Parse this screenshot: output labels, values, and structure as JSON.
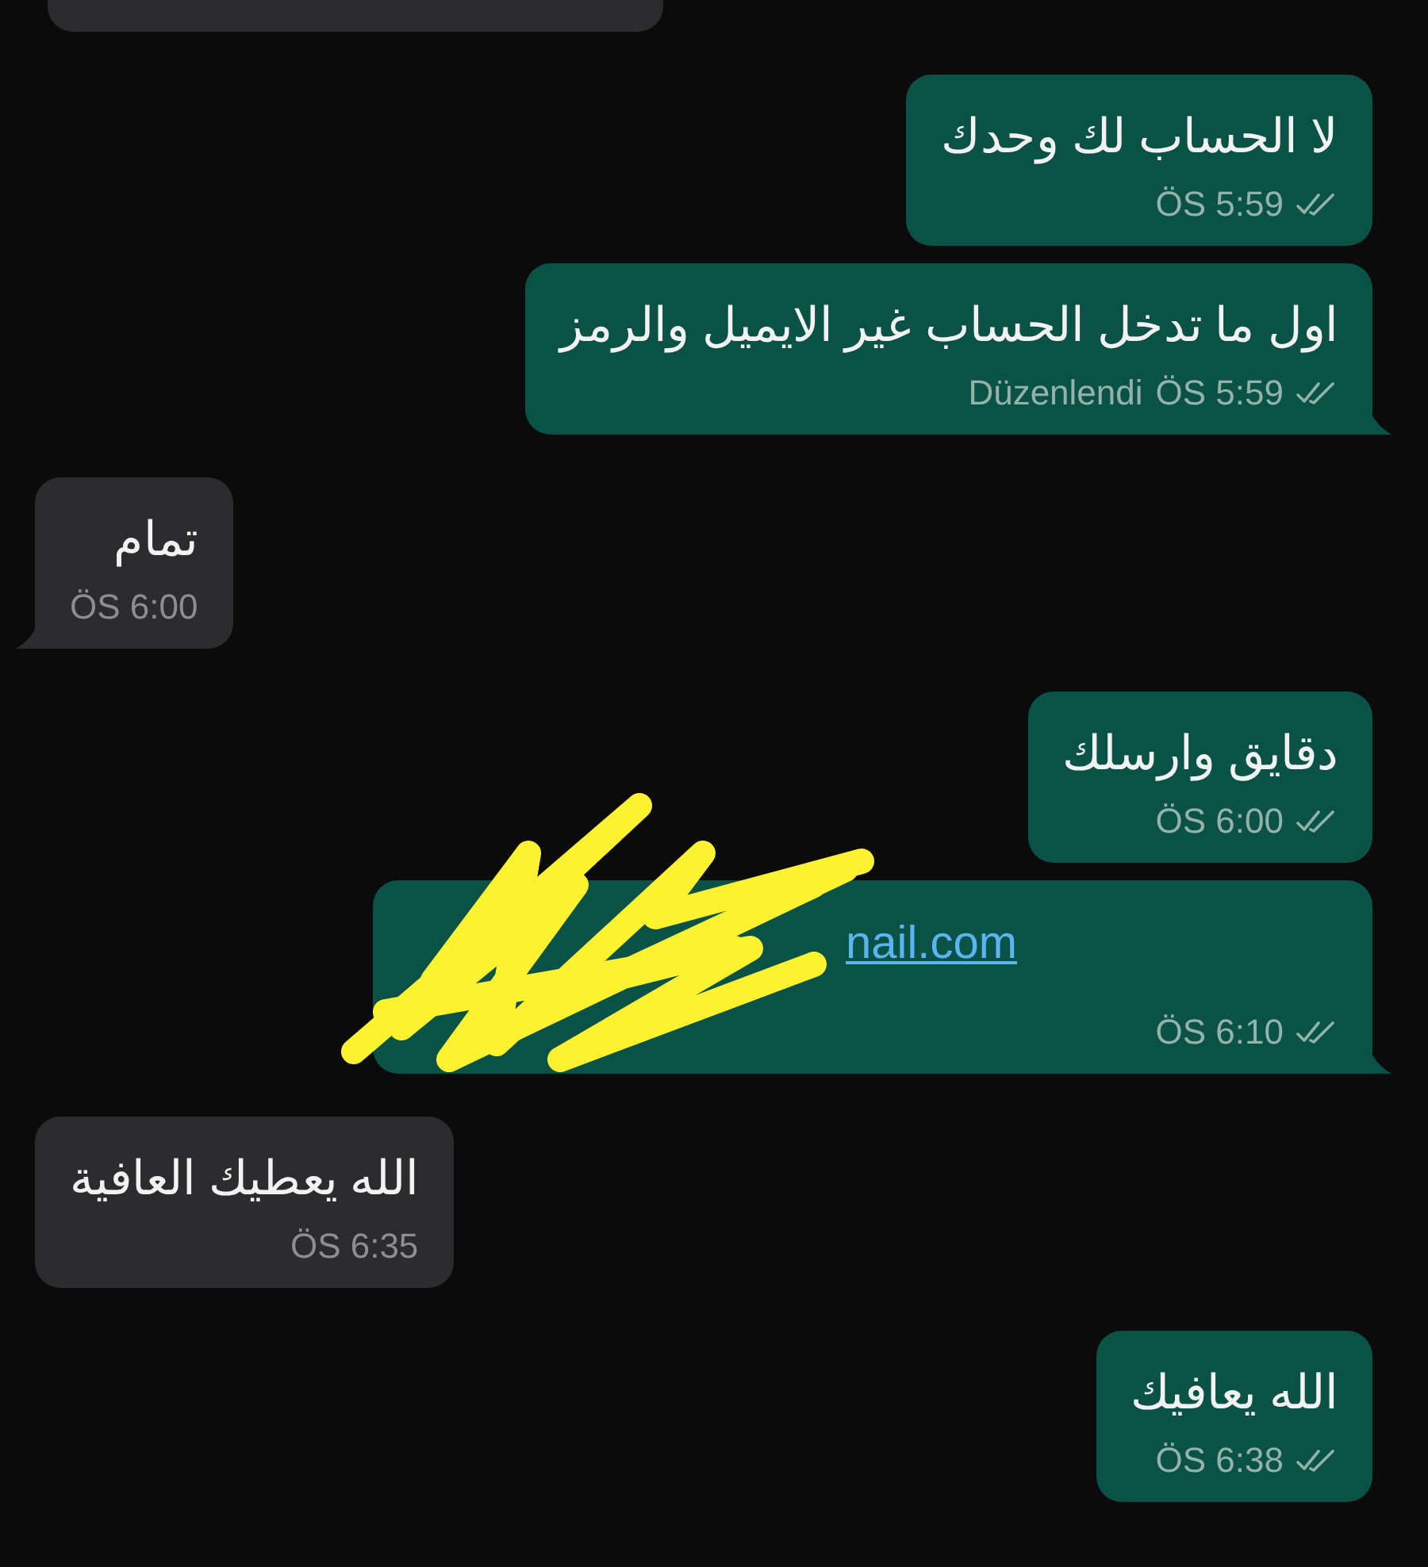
{
  "messages": [
    {
      "kind": "incoming",
      "tail": false
    },
    {
      "kind": "outgoing",
      "text": "لا الحساب لك وحدك",
      "time": "ÖS 5:59",
      "read": false,
      "tail": false
    },
    {
      "kind": "outgoing",
      "text": "اول ما تدخل الحساب غير الايميل والرمز",
      "edited_label": "Düzenlendi",
      "time": "ÖS 5:59",
      "read": false,
      "tail": true
    },
    {
      "kind": "incoming",
      "text": "تمام",
      "time": "ÖS 6:00",
      "tail": true
    },
    {
      "kind": "outgoing",
      "text": "دقايق وارسلك",
      "time": "ÖS 6:00",
      "read": false,
      "tail": false
    },
    {
      "kind": "outgoing",
      "link": "nail.com",
      "redacted": true,
      "time": "ÖS 6:10",
      "read": false,
      "tail": true
    },
    {
      "kind": "incoming",
      "text": "الله يعطيك العافية",
      "time": "ÖS 6:35",
      "tail": false
    },
    {
      "kind": "outgoing",
      "text": "الله يعافيك",
      "time": "ÖS 6:38",
      "read": false,
      "tail": false
    }
  ]
}
